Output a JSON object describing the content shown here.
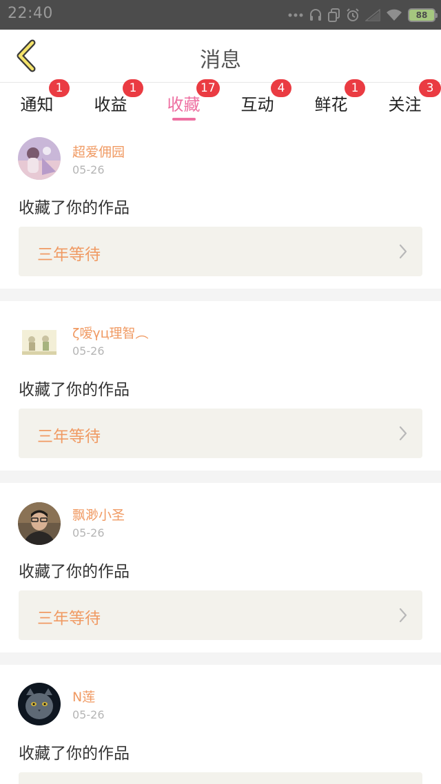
{
  "status_bar": {
    "time": "22:40",
    "battery": "88",
    "icons": [
      "dots-icon",
      "headset-icon",
      "copy-icon",
      "alarm-icon",
      "signal-icon",
      "wifi-icon",
      "battery-icon"
    ]
  },
  "header": {
    "title": "消息",
    "back_icon": "chevron-left-icon"
  },
  "tabs": [
    {
      "label": "通知",
      "badge": "1",
      "active": false
    },
    {
      "label": "收益",
      "badge": "1",
      "active": false
    },
    {
      "label": "收藏",
      "badge": "17",
      "active": true
    },
    {
      "label": "互动",
      "badge": "4",
      "active": false
    },
    {
      "label": "鲜花",
      "badge": "1",
      "active": false
    },
    {
      "label": "关注",
      "badge": "3",
      "active": false
    }
  ],
  "feed": [
    {
      "username": "超爱佣园",
      "date": "05-26",
      "action": "收藏了你的作品",
      "work_title": "三年等待"
    },
    {
      "username": "ζ嗳γц理智︵",
      "date": "05-26",
      "action": "收藏了你的作品",
      "work_title": "三年等待"
    },
    {
      "username": "飘渺小圣",
      "date": "05-26",
      "action": "收藏了你的作品",
      "work_title": "三年等待"
    },
    {
      "username": "N莲",
      "date": "05-26",
      "action": "收藏了你的作品",
      "work_title": ""
    }
  ],
  "colors": {
    "accent_pink": "#ee6fa1",
    "username_orange": "#f09a63",
    "badge_red": "#ea3b42",
    "work_box_bg": "#f3f2ec",
    "status_bar_bg": "#4c4c4c"
  }
}
